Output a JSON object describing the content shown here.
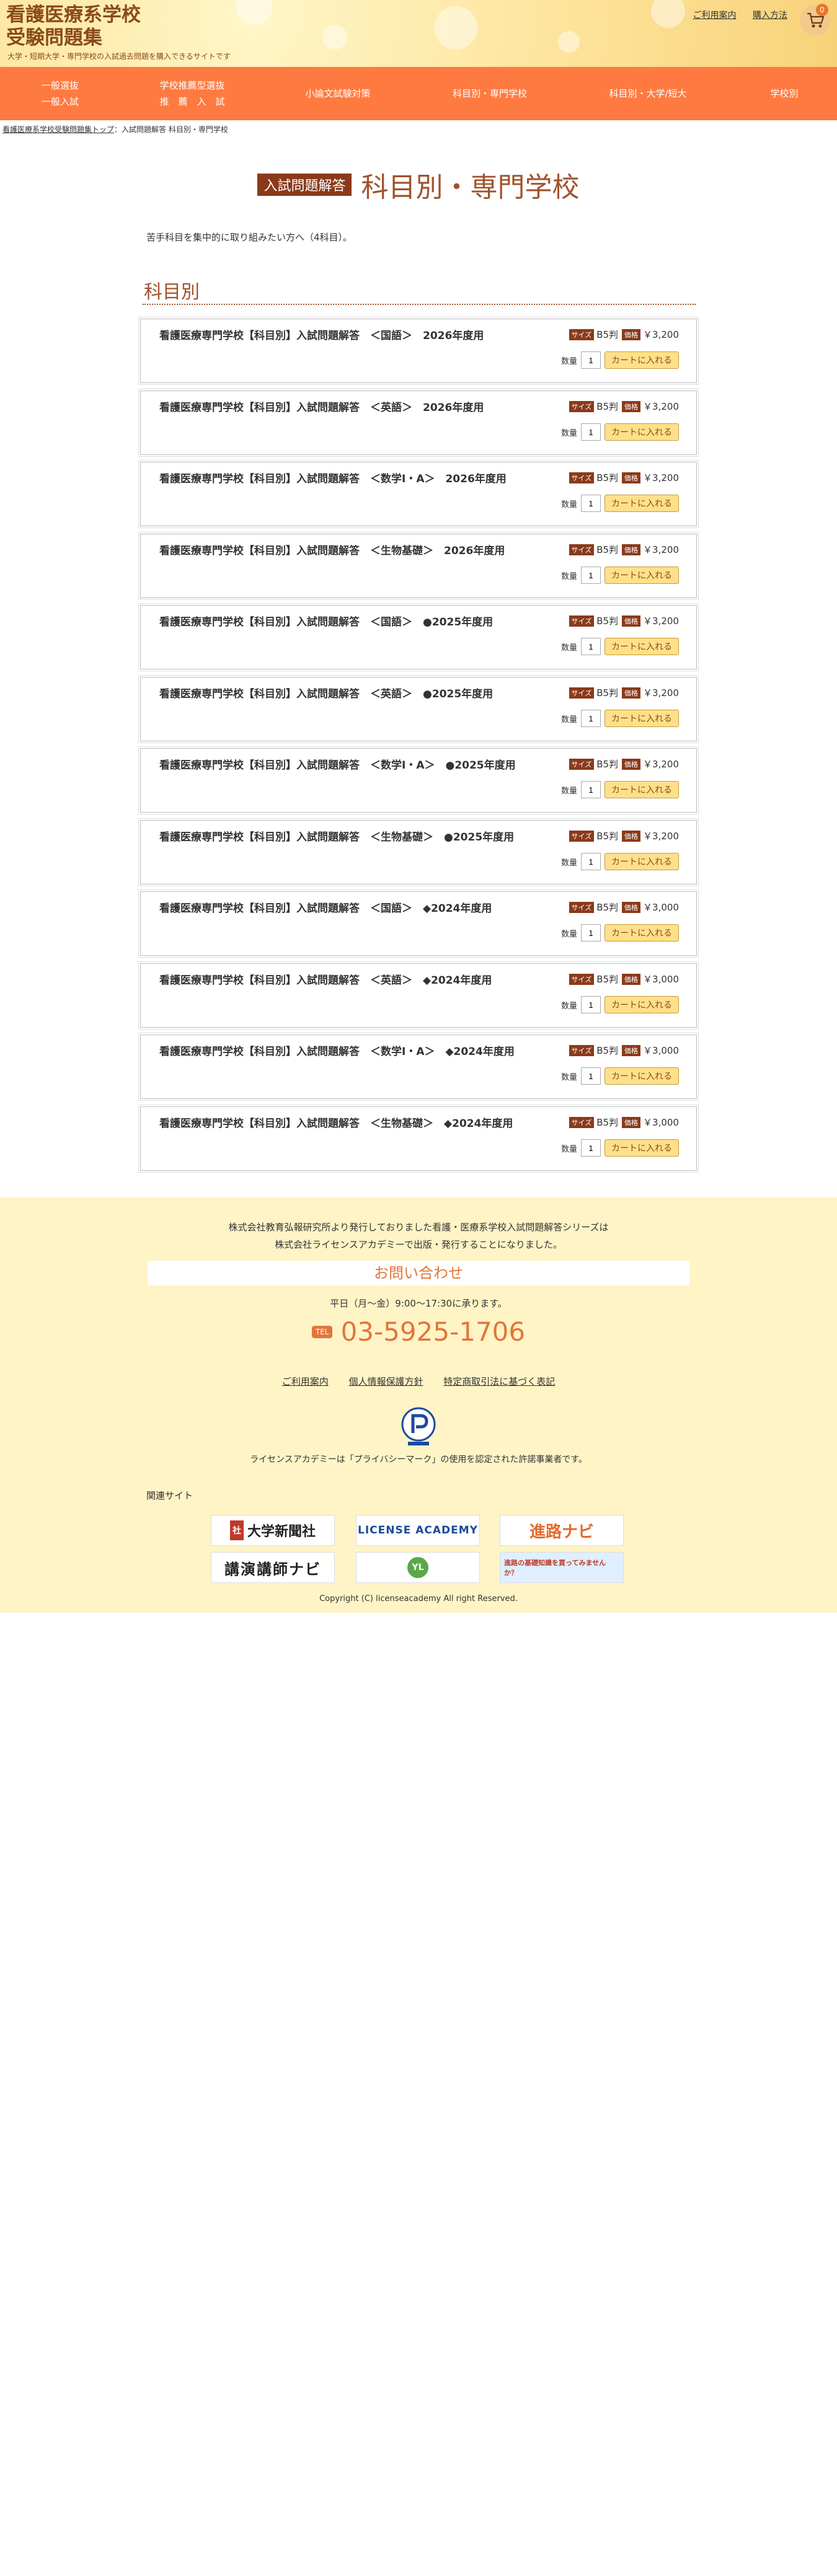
{
  "header": {
    "title_line1": "看護医療系学校",
    "title_line2": "受験問題集",
    "subtitle": "大学・短期大学・専門学校の入試過去問題を購入できるサイトです",
    "link_guide": "ご利用案内",
    "link_howto": "購入方法",
    "cart_count": "0"
  },
  "nav": {
    "item1_line1": "一般選抜",
    "item1_line2": "一般入試",
    "item2_line1": "学校推薦型選抜",
    "item2_line2": "推　薦　入　試",
    "item3": "小論文試験対策",
    "item4": "科目別・専門学校",
    "item5": "科目別・大学/短大",
    "item6": "学校別"
  },
  "breadcrumb": {
    "home": "看護医療系学校受験問題集トップ",
    "separator": "：",
    "current": "入試問題解答 科目別・専門学校"
  },
  "page": {
    "badge": "入試問題解答",
    "title": "科目別・専門学校",
    "intro": "苦手科目を集中的に取り組みたい方へ（4科目）。",
    "section_title": "科目別"
  },
  "labels": {
    "size_tag": "サイズ",
    "price_tag": "価格",
    "qty_label": "数量",
    "cart_button": "カートに入れる"
  },
  "products": [
    {
      "name": "看護医療専門学校【科目別】入試問題解答　＜国語＞　2026年度用",
      "size": "B5判",
      "price": "￥3,200",
      "qty": "1"
    },
    {
      "name": "看護医療専門学校【科目別】入試問題解答　＜英語＞　2026年度用",
      "size": "B5判",
      "price": "￥3,200",
      "qty": "1"
    },
    {
      "name": "看護医療専門学校【科目別】入試問題解答　＜数学Ⅰ・A＞　2026年度用",
      "size": "B5判",
      "price": "￥3,200",
      "qty": "1"
    },
    {
      "name": "看護医療専門学校【科目別】入試問題解答　＜生物基礎＞　2026年度用",
      "size": "B5判",
      "price": "￥3,200",
      "qty": "1"
    },
    {
      "name": "看護医療専門学校【科目別】入試問題解答　＜国語＞　●2025年度用",
      "size": "B5判",
      "price": "￥3,200",
      "qty": "1"
    },
    {
      "name": "看護医療専門学校【科目別】入試問題解答　＜英語＞　●2025年度用",
      "size": "B5判",
      "price": "￥3,200",
      "qty": "1"
    },
    {
      "name": "看護医療専門学校【科目別】入試問題解答　＜数学Ⅰ・A＞　●2025年度用",
      "size": "B5判",
      "price": "￥3,200",
      "qty": "1"
    },
    {
      "name": "看護医療専門学校【科目別】入試問題解答　＜生物基礎＞　●2025年度用",
      "size": "B5判",
      "price": "￥3,200",
      "qty": "1"
    },
    {
      "name": "看護医療専門学校【科目別】入試問題解答　＜国語＞　◆2024年度用",
      "size": "B5判",
      "price": "￥3,000",
      "qty": "1"
    },
    {
      "name": "看護医療専門学校【科目別】入試問題解答　＜英語＞　◆2024年度用",
      "size": "B5判",
      "price": "￥3,000",
      "qty": "1"
    },
    {
      "name": "看護医療専門学校【科目別】入試問題解答　＜数学Ⅰ・A＞　◆2024年度用",
      "size": "B5判",
      "price": "￥3,000",
      "qty": "1"
    },
    {
      "name": "看護医療専門学校【科目別】入試問題解答　＜生物基礎＞　◆2024年度用",
      "size": "B5判",
      "price": "￥3,000",
      "qty": "1"
    }
  ],
  "footer": {
    "note_line1": "株式会社教育弘報研究所より発行しておりました看護・医療系学校入試問題解答シリーズは",
    "note_line2": "株式会社ライセンスアカデミーで出版・発行することになりました。",
    "contact_title": "お問い合わせ",
    "hours": "平日（月〜金）9:00〜17:30に承ります。",
    "tel_badge": "TEL",
    "phone": "03-5925-1706",
    "link_guide": "ご利用案内",
    "link_privacy": "個人情報保護方針",
    "link_law": "特定商取引法に基づく表記",
    "pmark_text": "ライセンスアカデミーは「プライバシーマーク」の使用を認定された許諾事業者です。",
    "related_label": "関連サイト",
    "banner1": "大学新聞社",
    "banner2": "LICENSE ACADEMY",
    "banner3": "進路ナビ",
    "banner4": "講演講師ナビ",
    "banner5": "YL",
    "banner6": "進路の基礎知識を買ってみませんか？",
    "copyright": "Copyright (C) licenseacademy All right Reserved."
  },
  "colors": {
    "nav_bg": "#ff7a40",
    "accent_brown": "#8a3a1a",
    "title_brown": "#a0522d",
    "footer_bg": "#fff4c6",
    "phone_orange": "#e2763c"
  }
}
